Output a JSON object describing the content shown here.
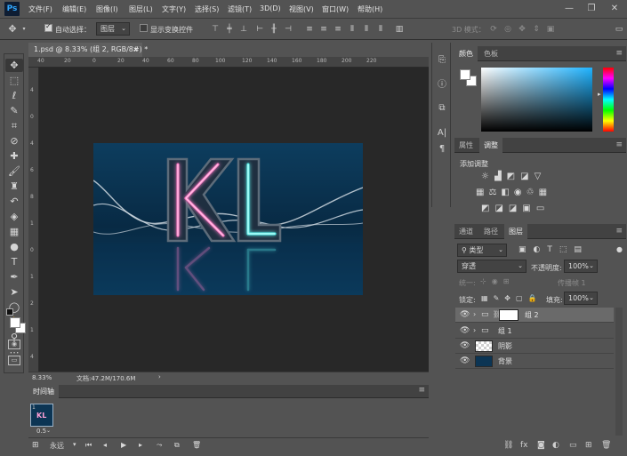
{
  "app": {
    "logo": "Ps"
  },
  "menu": [
    "文件(F)",
    "编辑(E)",
    "图像(I)",
    "图层(L)",
    "文字(Y)",
    "选择(S)",
    "滤镜(T)",
    "3D(D)",
    "视图(V)",
    "窗口(W)",
    "帮助(H)"
  ],
  "options": {
    "auto_select_label": "自动选择：",
    "auto_select_checked": true,
    "auto_select_target": "图层",
    "show_transform_label": "显示变换控件",
    "show_transform_checked": false,
    "mode_3d_label": "3D 模式："
  },
  "document": {
    "tab_title": "1.psd @ 8.33% (组 2, RGB/8#) *",
    "close_symbol": "×",
    "ruler_top": [
      "40",
      "20",
      "0",
      "20",
      "40",
      "60",
      "80",
      "100",
      "120",
      "140",
      "160",
      "180",
      "200",
      "220"
    ],
    "ruler_left": [
      "4",
      "0",
      "4",
      "6",
      "8",
      "1",
      "0",
      "1",
      "2",
      "1",
      "4"
    ],
    "canvas_text": "KL",
    "zoom": "8.33%",
    "doc_size": "文档:47.2M/170.6M"
  },
  "panels": {
    "color_tabs": [
      "颜色",
      "色板"
    ],
    "adjust_tabs": [
      "属性",
      "调整"
    ],
    "adjust_title": "添加调整",
    "layers_tabs": [
      "通道",
      "路径",
      "图层"
    ],
    "filter_kind": "类型",
    "blend_mode": "穿透",
    "opacity_label": "不透明度:",
    "opacity_value": "100%",
    "unify_label": "统一:",
    "propagate_label": "传播帧 1",
    "lock_label": "锁定:",
    "fill_label": "填充:",
    "fill_value": "100%",
    "layers": [
      {
        "name": "组 2",
        "type": "group",
        "selected": true
      },
      {
        "name": "组 1",
        "type": "group",
        "selected": false
      },
      {
        "name": "阴影",
        "type": "transparent",
        "selected": false
      },
      {
        "name": "背景",
        "type": "image",
        "selected": false
      }
    ]
  },
  "timeline": {
    "title": "时间轴",
    "frame_delay": "0.5",
    "loop": "永远"
  },
  "colors": {
    "app_bg": "#535353",
    "canvas_bg": "#0b3552",
    "neon_pink": "#ff7fc8",
    "neon_cyan": "#5ff5f0"
  }
}
